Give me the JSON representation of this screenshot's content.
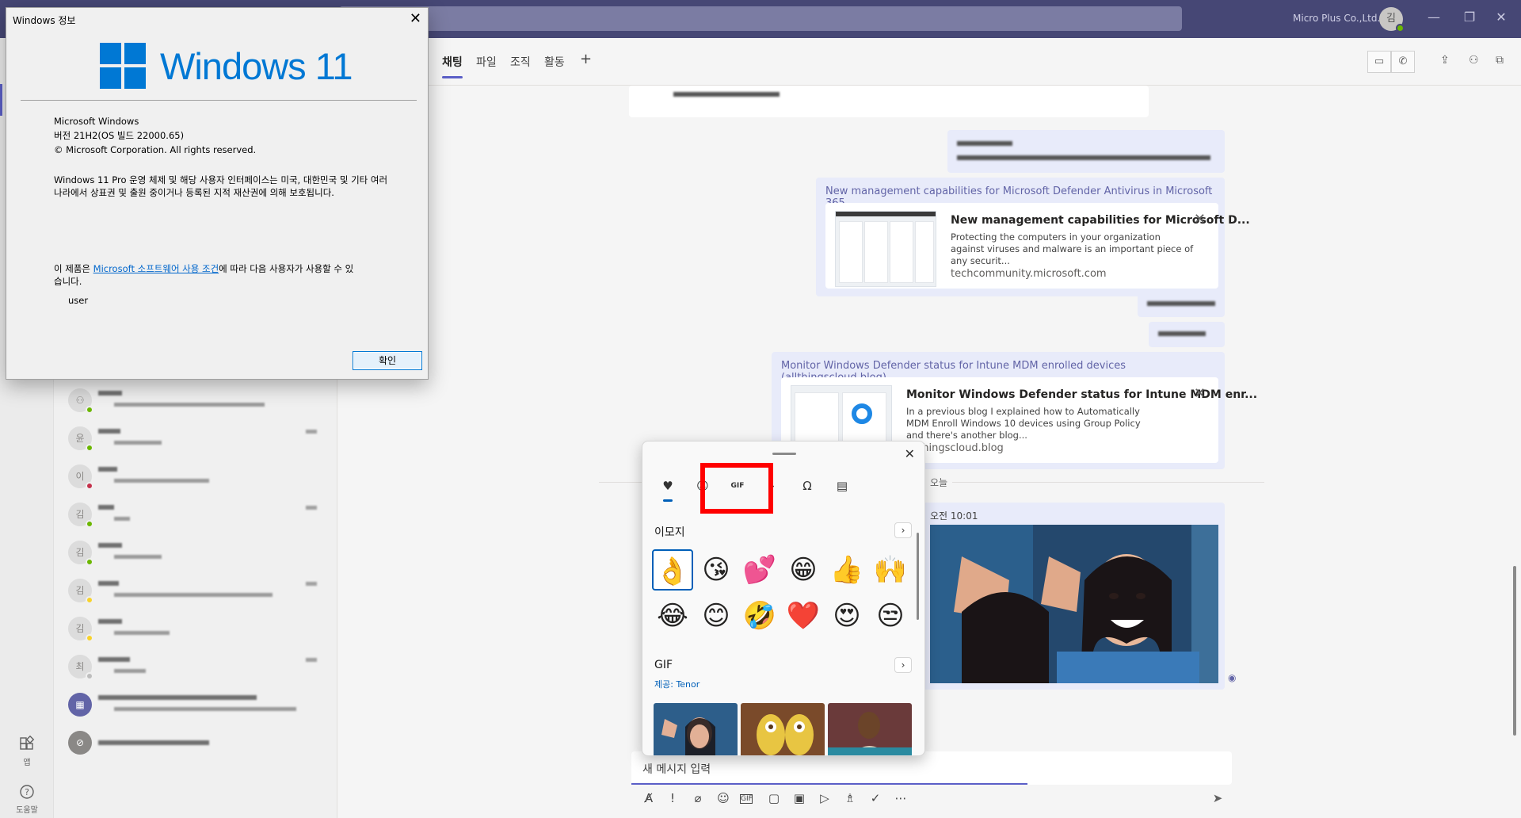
{
  "titlebar": {
    "org": "Micro Plus Co.,Ltd.",
    "avatar_initial": "김",
    "minimize": "—",
    "restore": "❐",
    "close": "✕"
  },
  "rail": {
    "apps_label": "앱",
    "help_label": "도움말"
  },
  "chat_list": {
    "rows": [
      {
        "initial": "",
        "status": "#6bb700"
      },
      {
        "initial": "윤",
        "status": "#6bb700"
      },
      {
        "initial": "이",
        "status": "#c4314b"
      },
      {
        "initial": "김",
        "status": "#6bb700"
      },
      {
        "initial": "김",
        "status": "#6bb700"
      },
      {
        "initial": "김",
        "status": "#f8d22a"
      },
      {
        "initial": "김",
        "status": "#f8d22a"
      },
      {
        "initial": "최",
        "status": "#bdbdbd"
      },
      {
        "initial": "",
        "status": ""
      },
      {
        "initial": "",
        "status": ""
      }
    ]
  },
  "tabs": {
    "chat": "채팅",
    "files": "파일",
    "org": "조직",
    "activity": "활동",
    "add": "+"
  },
  "messages": {
    "link1_text": "New management capabilities for Microsoft Defender Antivirus in Microsoft 365",
    "card1": {
      "title": "New management capabilities for Microsoft D...",
      "desc": "Protecting the computers in your organization against viruses and malware is an important piece of any securit...",
      "domain": "techcommunity.microsoft.com"
    },
    "link2_text": "Monitor Windows Defender status for Intune MDM enrolled devices (allthingscloud.blog)",
    "card2": {
      "title": "Monitor Windows Defender status for Intune MDM enr...",
      "desc": "In a previous blog I explained how to Automatically MDM Enroll Windows 10 devices using Group Policy and there's another blog...",
      "domain": "allthingscloud.blog"
    },
    "day_divider": "오늘",
    "image_time": "오전 10:01"
  },
  "composer": {
    "placeholder": "새 메시지 입력"
  },
  "picker": {
    "emoji_section": "이모지",
    "gif_section": "GIF",
    "provider": "제공: Tenor",
    "emojis": [
      "👌",
      "😘",
      "💕",
      "😁",
      "👍",
      "🙌",
      "😂",
      "😊",
      "🤣",
      "❤️",
      "😍",
      "😒"
    ]
  },
  "about": {
    "title": "Windows 정보",
    "logo_text": "Windows 11",
    "product": "Microsoft Windows",
    "version": "버전 21H2(OS 빌드 22000.65)",
    "copyright": "© Microsoft Corporation. All rights reserved.",
    "legal": "Windows 11 Pro 운영 체제 및 해당 사용자 인터페이스는 미국, 대한민국 및 기타 여러 나라에서 상표권 및 출원 중이거나 등록된 지적 재산권에 의해 보호됩니다.",
    "license_prefix": "이 제품은 ",
    "license_link": "Microsoft 소프트웨어 사용 조건",
    "license_suffix": "에 따라 다음 사용자가 사용할 수 있습니다.",
    "user": "user",
    "ok": "확인"
  },
  "colors": {
    "teams_purple": "#464775",
    "accent": "#5b5fc7",
    "highlight_box": "#ff0000",
    "windows_blue": "#0078d4"
  }
}
